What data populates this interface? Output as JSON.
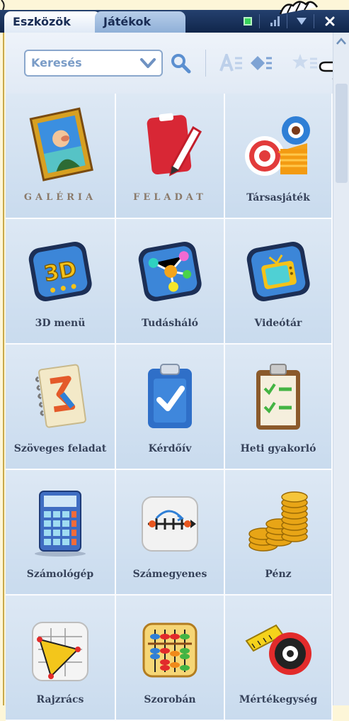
{
  "tabs": [
    {
      "label": "Eszközök",
      "active": true
    },
    {
      "label": "Játékok",
      "active": false
    }
  ],
  "titlebar": {
    "buttons": [
      "green-square-icon",
      "signal-bars-icon",
      "dropdown-triangle-icon",
      "close-icon"
    ]
  },
  "toolbar": {
    "search_value": "Keresés",
    "buttons": [
      "search-icon",
      "sort-alpha-icon",
      "sort-direction-icon",
      "favorites-star-icon"
    ]
  },
  "tiles": [
    {
      "label": "GALÉRIA",
      "icon": "gallery-icon"
    },
    {
      "label": "FELADAT",
      "icon": "task-icon"
    },
    {
      "label": "Társasjáték",
      "icon": "board-game-icon"
    },
    {
      "label": "3D menü",
      "icon": "3d-menu-icon"
    },
    {
      "label": "Tudásháló",
      "icon": "knowledge-network-icon"
    },
    {
      "label": "Videótár",
      "icon": "video-library-icon"
    },
    {
      "label": "Szöveges feladat",
      "icon": "word-problem-icon"
    },
    {
      "label": "Kérdőív",
      "icon": "questionnaire-icon"
    },
    {
      "label": "Heti gyakorló",
      "icon": "weekly-practice-icon"
    },
    {
      "label": "Számológép",
      "icon": "calculator-icon"
    },
    {
      "label": "Számegyenes",
      "icon": "number-line-icon"
    },
    {
      "label": "Pénz",
      "icon": "money-icon"
    },
    {
      "label": "Rajzrács",
      "icon": "drawing-grid-icon"
    },
    {
      "label": "Szorobán",
      "icon": "soroban-icon"
    },
    {
      "label": "Mértékegység",
      "icon": "measuring-tape-icon"
    }
  ],
  "colors": {
    "titlebar": "#1a2f58",
    "tile_bg": "#d4e2f1",
    "accent": "#2f7fd6"
  }
}
